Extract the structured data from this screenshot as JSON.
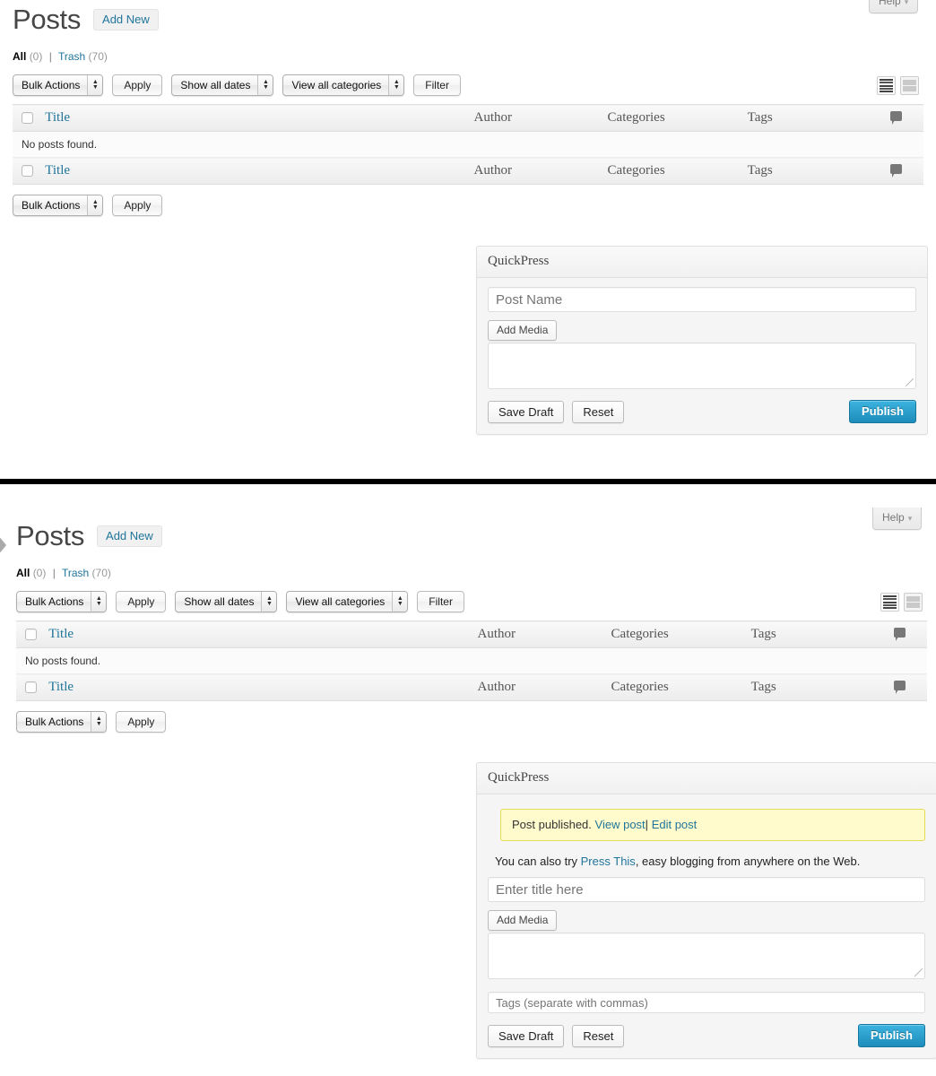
{
  "panels": [
    {
      "id": "panel-top",
      "help": {
        "label": "Help",
        "caret": "▾"
      },
      "title": "Posts",
      "add_new": "Add New",
      "subsub": {
        "all_label": "All",
        "all_count": "(0)",
        "separator": "|",
        "trash_label": "Trash",
        "trash_count": "(70)"
      },
      "filters": {
        "bulk_actions": "Bulk Actions",
        "apply": "Apply",
        "show_all_dates": "Show all dates",
        "view_all_categories": "View all categories",
        "filter": "Filter"
      },
      "view_switcher": {
        "list": "list-view",
        "excerpt": "excerpt-view"
      },
      "table": {
        "columns": [
          "Title",
          "Author",
          "Categories",
          "Tags"
        ],
        "comment_icon": "comment-bubble",
        "empty_message": "No posts found."
      },
      "footer_filters": {
        "bulk_actions": "Bulk Actions",
        "apply": "Apply"
      },
      "quickpress": {
        "heading": "QuickPress",
        "title_placeholder": "Post Name",
        "add_media": "Add Media",
        "content_value": "",
        "save_draft": "Save Draft",
        "reset": "Reset",
        "publish": "Publish"
      }
    },
    {
      "id": "panel-bottom",
      "help": {
        "label": "Help",
        "caret": "▾"
      },
      "title": "Posts",
      "add_new": "Add New",
      "subsub": {
        "all_label": "All",
        "all_count": "(0)",
        "separator": "|",
        "trash_label": "Trash",
        "trash_count": "(70)"
      },
      "filters": {
        "bulk_actions": "Bulk Actions",
        "apply": "Apply",
        "show_all_dates": "Show all dates",
        "view_all_categories": "View all categories",
        "filter": "Filter"
      },
      "view_switcher": {
        "list": "list-view",
        "excerpt": "excerpt-view"
      },
      "table": {
        "columns": [
          "Title",
          "Author",
          "Categories",
          "Tags"
        ],
        "comment_icon": "comment-bubble",
        "empty_message": "No posts found."
      },
      "footer_filters": {
        "bulk_actions": "Bulk Actions",
        "apply": "Apply"
      },
      "quickpress": {
        "heading": "QuickPress",
        "notice": {
          "text": "Post published.",
          "view_post": "View post",
          "separator": "|",
          "edit_post": "Edit post"
        },
        "press_this": {
          "before": "You can also try ",
          "link": "Press This",
          "after": ", easy blogging from anywhere on the Web."
        },
        "title_placeholder": "Enter title here",
        "add_media": "Add Media",
        "content_value": "",
        "tags_placeholder": "Tags (separate with commas)",
        "save_draft": "Save Draft",
        "reset": "Reset",
        "publish": "Publish"
      }
    }
  ],
  "colors": {
    "link": "#21759b",
    "publish": "#1e8cba",
    "notice_bg": "#fffbcc",
    "notice_border": "#e6db55",
    "title": "#464646"
  }
}
